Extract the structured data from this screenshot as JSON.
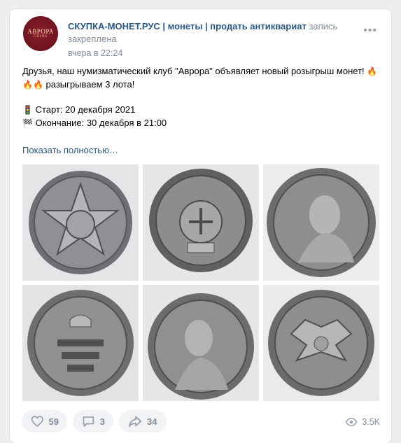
{
  "post": {
    "avatar": {
      "top_text": "АВРОРА",
      "bottom_text": "COINS"
    },
    "author": "СКУПКА-МОНЕТ.РУС | монеты | продать антиквариат",
    "pinned_note": "запись закреплена",
    "time": "вчера в 22:24",
    "menu_icon": "more-dots-icon",
    "text": {
      "line1": "Друзья, наш нумизматический клуб \"Аврора\" объявляет новый розыгрыш монет! ",
      "line1_tail": "🔥🔥🔥",
      "line2": " разыгрываем 3 лота!",
      "start_icon": "🚦",
      "start": "Старт: 20 декабря 2021",
      "end_icon": "🏁",
      "end": "Окончание: 30 декабря в 21:00"
    },
    "show_more": "Показать полностью…",
    "photos": [
      {
        "name": "coin-50-kopeks-1922"
      },
      {
        "name": "coin-soviet-emblem"
      },
      {
        "name": "coin-empress-portrait"
      },
      {
        "name": "coin-grivennik-1751"
      },
      {
        "name": "coin-catherine-portrait"
      },
      {
        "name": "coin-double-eagle"
      }
    ],
    "actions": {
      "likes": "59",
      "comments": "3",
      "shares": "34",
      "views": "3.5K"
    }
  }
}
